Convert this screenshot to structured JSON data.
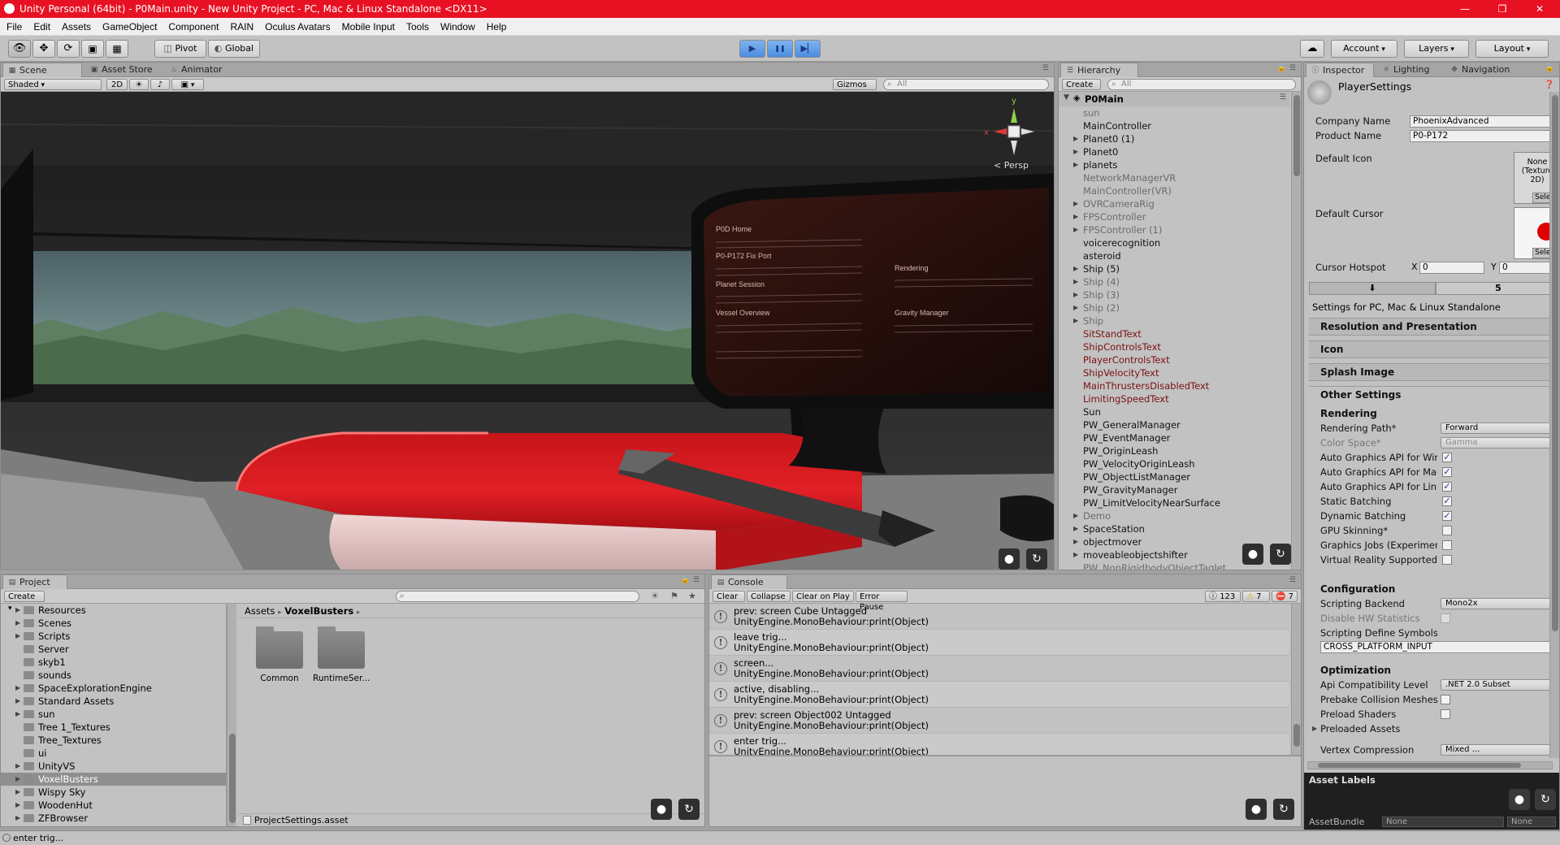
{
  "titlebar": {
    "title": "Unity Personal (64bit) - P0Main.unity - New Unity Project - PC, Mac & Linux Standalone <DX11>",
    "minimize": "—",
    "restore": "❐",
    "close": "✕"
  },
  "menu": [
    "File",
    "Edit",
    "Assets",
    "GameObject",
    "Component",
    "RAIN",
    "Oculus Avatars",
    "Mobile Input",
    "Tools",
    "Window",
    "Help"
  ],
  "toolbar": {
    "pivot": "Pivot",
    "global": "Global",
    "play": "▶",
    "pause": "❚❚",
    "step": "▶▏",
    "cloud": "☁",
    "account": "Account",
    "layers": "Layers",
    "layout": "Layout"
  },
  "scene": {
    "tabs": {
      "scene": "Scene",
      "asset_store": "Asset Store",
      "animator": "Animator"
    },
    "shading": "Shaded",
    "mode2d": "2D",
    "sun": "☀",
    "audio": "♪",
    "image": "▣",
    "gizmos": "Gizmos",
    "search_placeholder": "All",
    "persp": "< Persp",
    "axis_x": "x",
    "axis_y": "y",
    "monitor_lines": [
      "P0D Home",
      "P0-P172 Fix Port",
      "Planet Session",
      "Vessel Overview",
      "Rendering",
      "Gravity Manager"
    ]
  },
  "hierarchy": {
    "tab": "Hierarchy",
    "create": "Create",
    "search_placeholder": "All",
    "root": "P0Main",
    "items": [
      {
        "name": "sun",
        "arrow": "",
        "style": "inactive"
      },
      {
        "name": "MainController",
        "arrow": "",
        "style": ""
      },
      {
        "name": "Planet0 (1)",
        "arrow": "▶",
        "style": ""
      },
      {
        "name": "Planet0",
        "arrow": "▶",
        "style": ""
      },
      {
        "name": "planets",
        "arrow": "▶",
        "style": ""
      },
      {
        "name": "NetworkManagerVR",
        "arrow": "",
        "style": "inactive"
      },
      {
        "name": "MainController(VR)",
        "arrow": "",
        "style": "inactive"
      },
      {
        "name": "OVRCameraRig",
        "arrow": "▶",
        "style": "inactive"
      },
      {
        "name": "FPSController",
        "arrow": "▶",
        "style": "inactive"
      },
      {
        "name": "FPSController (1)",
        "arrow": "▶",
        "style": "inactive"
      },
      {
        "name": "voicerecognition",
        "arrow": "",
        "style": ""
      },
      {
        "name": "asteroid",
        "arrow": "",
        "style": ""
      },
      {
        "name": "Ship (5)",
        "arrow": "▶",
        "style": ""
      },
      {
        "name": "Ship (4)",
        "arrow": "▶",
        "style": "inactive"
      },
      {
        "name": "Ship (3)",
        "arrow": "▶",
        "style": "inactive"
      },
      {
        "name": "Ship (2)",
        "arrow": "▶",
        "style": "inactive"
      },
      {
        "name": "Ship",
        "arrow": "▶",
        "style": "inactive"
      },
      {
        "name": "SitStandText",
        "arrow": "",
        "style": "broken"
      },
      {
        "name": "ShipControlsText",
        "arrow": "",
        "style": "broken"
      },
      {
        "name": "PlayerControlsText",
        "arrow": "",
        "style": "broken"
      },
      {
        "name": "ShipVelocityText",
        "arrow": "",
        "style": "broken"
      },
      {
        "name": "MainThrustersDisabledText",
        "arrow": "",
        "style": "broken"
      },
      {
        "name": "LimitingSpeedText",
        "arrow": "",
        "style": "broken"
      },
      {
        "name": "Sun",
        "arrow": "",
        "style": ""
      },
      {
        "name": "PW_GeneralManager",
        "arrow": "",
        "style": ""
      },
      {
        "name": "PW_EventManager",
        "arrow": "",
        "style": ""
      },
      {
        "name": "PW_OriginLeash",
        "arrow": "",
        "style": ""
      },
      {
        "name": "PW_VelocityOriginLeash",
        "arrow": "",
        "style": ""
      },
      {
        "name": "PW_ObjectListManager",
        "arrow": "",
        "style": ""
      },
      {
        "name": "PW_GravityManager",
        "arrow": "",
        "style": ""
      },
      {
        "name": "PW_LimitVelocityNearSurface",
        "arrow": "",
        "style": ""
      },
      {
        "name": "Demo",
        "arrow": "▶",
        "style": "inactive"
      },
      {
        "name": "SpaceStation",
        "arrow": "▶",
        "style": ""
      },
      {
        "name": "objectmover",
        "arrow": "▶",
        "style": ""
      },
      {
        "name": "moveableobjectshifter",
        "arrow": "▶",
        "style": ""
      },
      {
        "name": "PW_NonRigidbodyObjectTaglet",
        "arrow": "",
        "style": "inactive"
      }
    ]
  },
  "inspector": {
    "tabs": {
      "inspector": "Inspector",
      "lighting": "Lighting",
      "navigation": "Navigation"
    },
    "title": "PlayerSettings",
    "company_label": "Company Name",
    "company_value": "PhoenixAdvanced",
    "product_label": "Product Name",
    "product_value": "P0-P172",
    "default_icon_label": "Default Icon",
    "icon_none": "None (Texture 2D)",
    "select": "Select",
    "default_cursor_label": "Default Cursor",
    "cursor_hotspot_label": "Cursor Hotspot",
    "hotspot_x_label": "X",
    "hotspot_x": "0",
    "hotspot_y_label": "Y",
    "hotspot_y": "0",
    "platform_download": "⬇",
    "platform_html": "5",
    "settings_for": "Settings for PC, Mac & Linux Standalone",
    "sections": {
      "resolution": "Resolution and Presentation",
      "icon": "Icon",
      "splash": "Splash Image",
      "other": "Other Settings"
    },
    "rendering_head": "Rendering",
    "rendering_path_label": "Rendering Path*",
    "rendering_path_value": "Forward",
    "color_space_label": "Color Space*",
    "color_space_value": "Gamma",
    "check_rows": [
      {
        "label": "Auto Graphics API for Windows",
        "checked": "✓",
        "disabled": false
      },
      {
        "label": "Auto Graphics API for Mac",
        "checked": "✓",
        "disabled": false
      },
      {
        "label": "Auto Graphics API for Linux",
        "checked": "✓",
        "disabled": false
      },
      {
        "label": "Static Batching",
        "checked": "✓",
        "disabled": false
      },
      {
        "label": "Dynamic Batching",
        "checked": "✓",
        "disabled": false
      },
      {
        "label": "GPU Skinning*",
        "checked": "",
        "disabled": false
      },
      {
        "label": "Graphics Jobs (Experimental)",
        "checked": "",
        "disabled": false
      },
      {
        "label": "Virtual Reality Supported",
        "checked": "",
        "disabled": false
      }
    ],
    "configuration_head": "Configuration",
    "scripting_backend_label": "Scripting Backend",
    "scripting_backend_value": "Mono2x",
    "disable_hw_label": "Disable HW Statistics",
    "define_symbols_label": "Scripting Define Symbols",
    "define_symbols_value": "CROSS_PLATFORM_INPUT",
    "optimization_head": "Optimization",
    "api_compat_label": "Api Compatibility Level",
    "api_compat_value": ".NET 2.0 Subset",
    "prebake_label": "Prebake Collision Meshes",
    "preload_shaders_label": "Preload Shaders",
    "preloaded_assets_label": "Preloaded Assets",
    "vertex_compression_label": "Vertex Compression",
    "vertex_compression_value": "Mixed ...",
    "asset_labels": "Asset Labels",
    "asset_bundle_label": "AssetBundle",
    "asset_bundle_value": "None",
    "asset_bundle_variant": "None"
  },
  "project": {
    "tab": "Project",
    "create": "Create",
    "folders": [
      {
        "name": "Resources",
        "arrow": "▶",
        "selected": false
      },
      {
        "name": "Scenes",
        "arrow": "▶",
        "selected": false
      },
      {
        "name": "Scripts",
        "arrow": "▶",
        "selected": false
      },
      {
        "name": "Server",
        "arrow": "",
        "selected": false
      },
      {
        "name": "skyb1",
        "arrow": "",
        "selected": false
      },
      {
        "name": "sounds",
        "arrow": "",
        "selected": false
      },
      {
        "name": "SpaceExplorationEngine",
        "arrow": "▶",
        "selected": false
      },
      {
        "name": "Standard Assets",
        "arrow": "▶",
        "selected": false
      },
      {
        "name": "sun",
        "arrow": "▶",
        "selected": false
      },
      {
        "name": "Tree 1_Textures",
        "arrow": "",
        "selected": false
      },
      {
        "name": "Tree_Textures",
        "arrow": "",
        "selected": false
      },
      {
        "name": "ui",
        "arrow": "",
        "selected": false
      },
      {
        "name": "UnityVS",
        "arrow": "▶",
        "selected": false
      },
      {
        "name": "VoxelBusters",
        "arrow": "▶",
        "selected": true
      },
      {
        "name": "Wispy Sky",
        "arrow": "▶",
        "selected": false
      },
      {
        "name": "WoodenHut",
        "arrow": "▶",
        "selected": false
      },
      {
        "name": "ZFBrowser",
        "arrow": "▶",
        "selected": false
      }
    ],
    "breadcrumb_root": "Assets",
    "breadcrumb_sep": "▸",
    "breadcrumb_current": "VoxelBusters",
    "grid_items": [
      "Common",
      "RuntimeSer..."
    ],
    "footer_file": "ProjectSettings.asset"
  },
  "console": {
    "tab": "Console",
    "buttons": {
      "clear": "Clear",
      "collapse": "Collapse",
      "clear_on_play": "Clear on Play",
      "error_pause": "Error Pause"
    },
    "counts": {
      "info": "123",
      "warn": "7",
      "error": "7"
    },
    "entries": [
      {
        "line1": "prev: screen Cube Untagged",
        "line2": "UnityEngine.MonoBehaviour:print(Object)"
      },
      {
        "line1": "leave trig...",
        "line2": "UnityEngine.MonoBehaviour:print(Object)"
      },
      {
        "line1": "screen...",
        "line2": "UnityEngine.MonoBehaviour:print(Object)"
      },
      {
        "line1": "active, disabling...",
        "line2": "UnityEngine.MonoBehaviour:print(Object)"
      },
      {
        "line1": "prev: screen Object002 Untagged",
        "line2": "UnityEngine.MonoBehaviour:print(Object)"
      },
      {
        "line1": "enter trig...",
        "line2": "UnityEngine.MonoBehaviour:print(Object)"
      }
    ]
  },
  "icons": {
    "mic": "🎙",
    "refresh": "↻"
  },
  "status": "enter trig..."
}
